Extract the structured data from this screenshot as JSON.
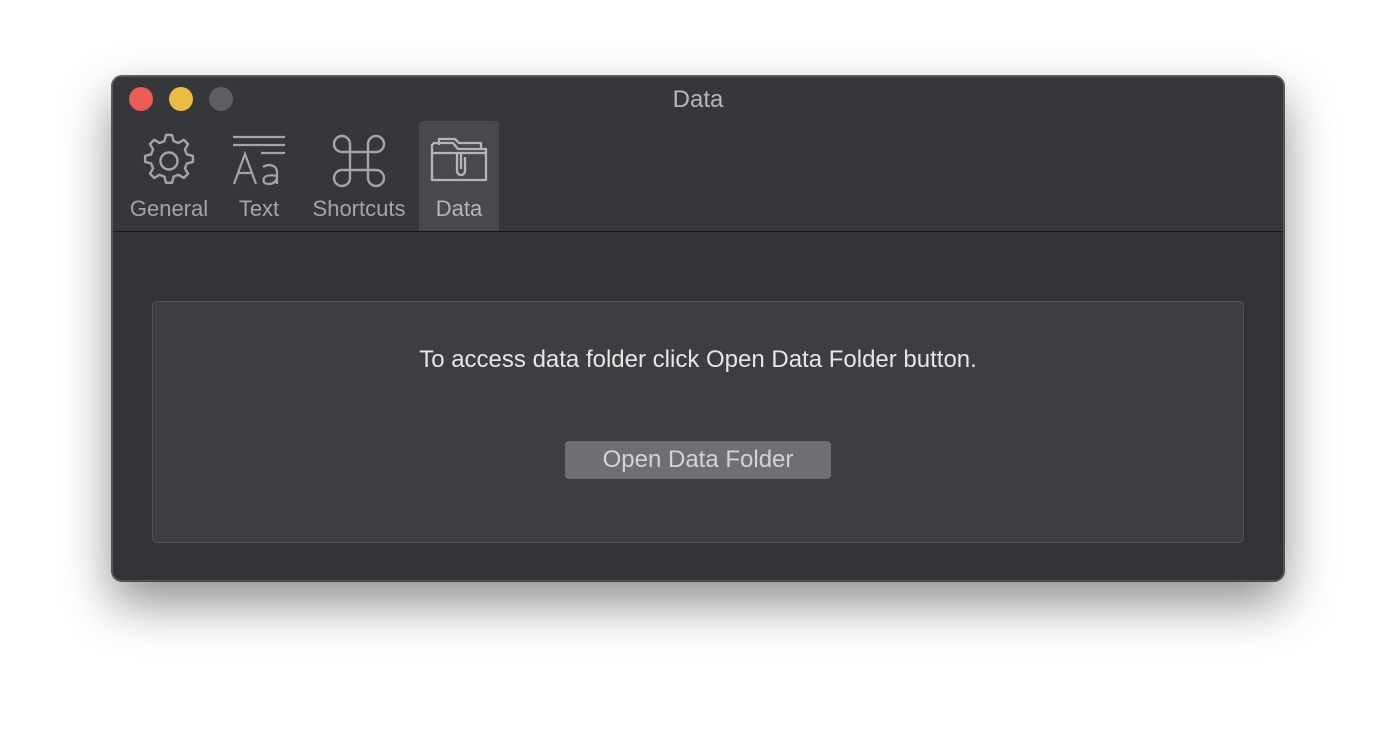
{
  "window": {
    "title": "Data"
  },
  "tabs": [
    {
      "label": "General",
      "icon": "gear-icon"
    },
    {
      "label": "Text",
      "icon": "text-format-icon"
    },
    {
      "label": "Shortcuts",
      "icon": "command-icon"
    },
    {
      "label": "Data",
      "icon": "folder-icon",
      "selected": true
    }
  ],
  "panel": {
    "message": "To access data folder click Open Data Folder button.",
    "button_label": "Open Data Folder"
  },
  "colors": {
    "close": "#ee5a55",
    "minimize": "#e8bd42",
    "zoom": "#5d5e61",
    "window_bg": "#323336",
    "selected_tab_bg": "#47494c"
  }
}
